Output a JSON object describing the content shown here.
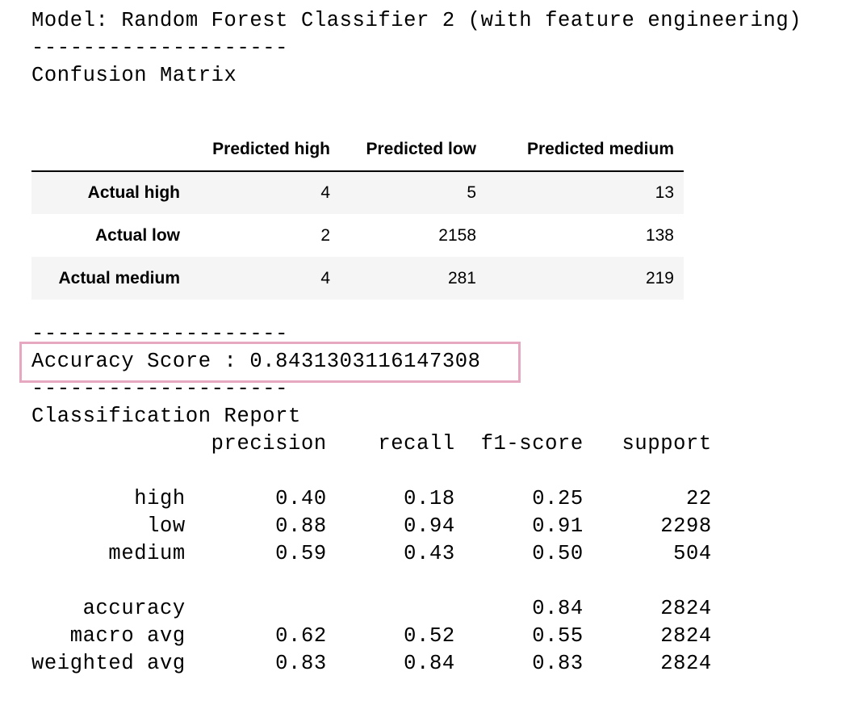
{
  "model_line": "Model: Random Forest Classifier 2 (with feature engineering)",
  "separator": "--------------------",
  "confusion_title": "Confusion Matrix",
  "confusion_matrix": {
    "headers": [
      "",
      "Predicted high",
      "Predicted low",
      "Predicted medium"
    ],
    "rows": [
      {
        "label": "Actual high",
        "values": [
          "4",
          "5",
          "13"
        ]
      },
      {
        "label": "Actual low",
        "values": [
          "2",
          "2158",
          "138"
        ]
      },
      {
        "label": "Actual medium",
        "values": [
          "4",
          "281",
          "219"
        ]
      }
    ]
  },
  "accuracy_line": "Accuracy Score : 0.8431303116147308",
  "highlight_color": "#e6a8c1",
  "report_title": "Classification Report",
  "report_lines": [
    "              precision    recall  f1-score   support",
    "",
    "        high       0.40      0.18      0.25        22",
    "         low       0.88      0.94      0.91      2298",
    "      medium       0.59      0.43      0.50       504",
    "",
    "    accuracy                           0.84      2824",
    "   macro avg       0.62      0.52      0.55      2824",
    "weighted avg       0.83      0.84      0.83      2824"
  ]
}
